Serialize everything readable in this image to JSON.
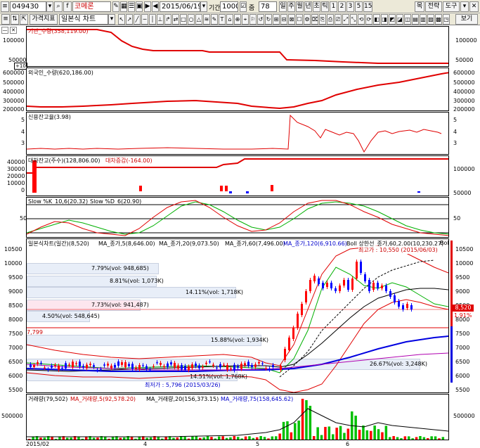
{
  "toolbar": {
    "code_value": "049430",
    "stock_name": "코메론",
    "date_value": "2015/06/19",
    "period_label": "기간",
    "period_value": "1000",
    "count_label": "줌",
    "count_value": "78",
    "tf_buttons": [
      "일",
      "주",
      "월",
      "년",
      "초",
      "틱",
      "1",
      "2",
      "3",
      "5",
      "15"
    ],
    "menu_buttons": [
      "목",
      "전략",
      "도구"
    ],
    "f_label": "f",
    "tab_price": "가격지표",
    "chart_type": "일본식 차트",
    "view_label": "보기"
  },
  "panels": {
    "insti": {
      "legend": "기관_수량(358,119.00)",
      "ticks": [
        "100000",
        "50000"
      ],
      "badge": "+10"
    },
    "foreign": {
      "legend": "외국인_수량(620,186.00)",
      "ticks": [
        "600000",
        "500000",
        "400000",
        "300000",
        "200000"
      ]
    },
    "credit": {
      "legend": "신용잔고율(3.98)",
      "ticks": [
        "5",
        "4",
        "3"
      ]
    },
    "loan": {
      "legend1": "대차잔고(주수)(128,806.00)",
      "legend2": "대차증감(-164.00)",
      "ticks": [
        "40000",
        "30000",
        "20000",
        "10000",
        "0"
      ],
      "rticks": [
        "100000",
        "50000"
      ],
      "badge": "+10"
    },
    "stoch": {
      "legend1": "Slow %K_10,6(20.32)",
      "legend2": "Slow %D_6(20.90)",
      "ticks": [
        "50"
      ]
    },
    "price": {
      "legend": [
        "일본식차트(일간)(8,520)",
        "MA_종가,5(8,646.00)",
        "MA_종가,20(9,073.50)",
        "MA_종가,60(7,496.00)",
        "MA_종가,120(6,910.66)",
        "Boll 상한선_종가,60,2.00(10,230.27)",
        "Boll"
      ],
      "ticks": [
        "10500",
        "10000",
        "9500",
        "9000",
        "8500",
        "8000",
        "7500",
        "7000",
        "6500",
        "6000",
        "5500"
      ],
      "current_price": "8,520",
      "change_pct": "1.91%",
      "high_label": "최고가 : 10,550 (2015/06/03)",
      "low_label": "최저가 : 5,796 (2015/03/26)",
      "ref_price": "7,799",
      "bands": [
        "7.79%(vol: 948,685)",
        "8.81%(vol: 1,073K)",
        "14.11%(vol: 1,718K)",
        "7.73%(vol: 941,487)",
        "4.50%(vol: 548,645)",
        "15.88%(vol: 1,934K)",
        "26.67%(vol: 3,248K)",
        "14.51%(vol: 1,768K)"
      ]
    },
    "volume": {
      "legend": [
        "거래량(79,502)",
        "MA_거래량,5(92,578.20)",
        "MA_거래량,20(156,373.15)",
        "MA_거래량,75(158,645.62)"
      ],
      "ticks": [
        "500000"
      ]
    }
  },
  "xaxis": [
    "2015/02",
    "4",
    "5",
    "6"
  ],
  "colors": {
    "up": "#ff0000",
    "down": "#0000ff",
    "panel_line": "#e00000"
  }
}
